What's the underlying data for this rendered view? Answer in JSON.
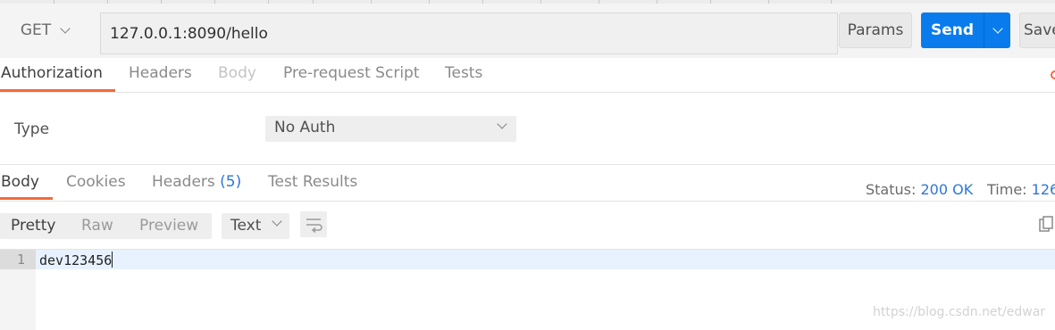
{
  "request": {
    "method": "GET",
    "url": "127.0.0.1:8090/hello",
    "params_label": "Params",
    "send_label": "Send",
    "save_label": "Save"
  },
  "request_tabs": [
    {
      "label": "Authorization",
      "state": "active"
    },
    {
      "label": "Headers",
      "state": "normal"
    },
    {
      "label": "Body",
      "state": "disabled"
    },
    {
      "label": "Pre-request Script",
      "state": "normal"
    },
    {
      "label": "Tests",
      "state": "normal"
    }
  ],
  "auth": {
    "type_label": "Type",
    "selected": "No Auth"
  },
  "response_tabs": [
    {
      "label": "Body",
      "state": "active"
    },
    {
      "label": "Cookies",
      "state": "normal"
    },
    {
      "label": "Headers",
      "count": "(5)",
      "state": "normal"
    },
    {
      "label": "Test Results",
      "state": "normal"
    }
  ],
  "response_meta": {
    "status_label": "Status:",
    "status_value": "200 OK",
    "time_label": "Time:",
    "time_value": "126"
  },
  "view_modes": [
    {
      "label": "Pretty",
      "state": "active"
    },
    {
      "label": "Raw",
      "state": "normal"
    },
    {
      "label": "Preview",
      "state": "normal"
    }
  ],
  "format": {
    "selected": "Text"
  },
  "response_body": {
    "lines": [
      {
        "number": "1",
        "text": "dev123456"
      }
    ]
  },
  "watermark": "https://blog.csdn.net/edwar",
  "colors": {
    "accent": "#097bed",
    "tab_underline": "#f26b3a",
    "status_value": "#2d78d6"
  },
  "icons": [
    "chevron-down-icon",
    "wrap-lines-icon",
    "copy-icon",
    "settings-dot-icon"
  ]
}
